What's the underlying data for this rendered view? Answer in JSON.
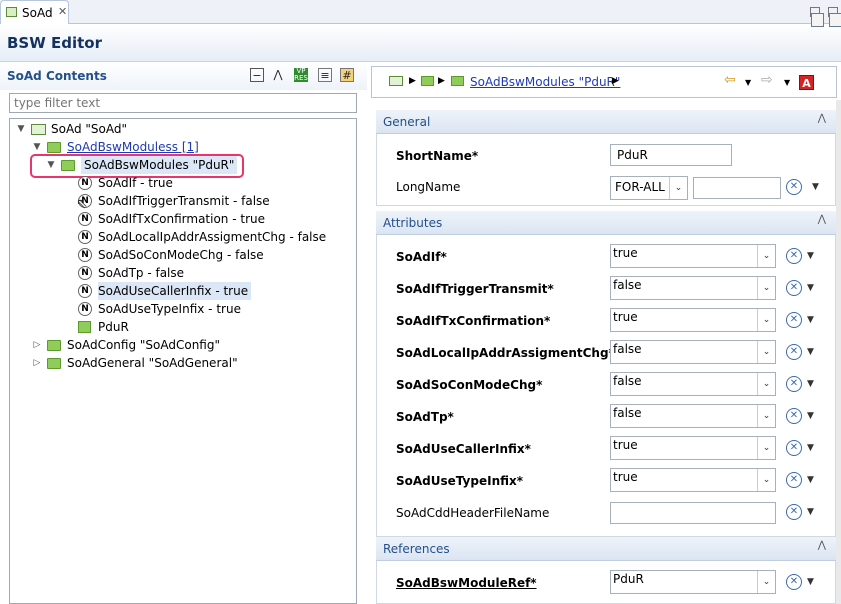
{
  "tab": {
    "label": "SoAd"
  },
  "header": {
    "title": "BSW Editor"
  },
  "left": {
    "title": "SoAd Contents",
    "filter_placeholder": "type filter text",
    "tree": [
      {
        "label": "SoAd \"SoAd\""
      },
      {
        "label": "SoAdBswModuless [1]"
      },
      {
        "label": "SoAdBswModules \"PduR\""
      },
      {
        "label": "SoAdIf - true"
      },
      {
        "label": "SoAdIfTriggerTransmit - false"
      },
      {
        "label": "SoAdIfTxConfirmation - true"
      },
      {
        "label": "SoAdLocalIpAddrAssigmentChg - false"
      },
      {
        "label": "SoAdSoConModeChg - false"
      },
      {
        "label": "SoAdTp - false"
      },
      {
        "label": "SoAdUseCallerInfix - true"
      },
      {
        "label": "SoAdUseTypeInfix - true"
      },
      {
        "label": "PduR"
      },
      {
        "label": "SoAdConfig \"SoAdConfig\""
      },
      {
        "label": "SoAdGeneral \"SoAdGeneral\""
      }
    ]
  },
  "breadcrumb": {
    "item": "SoAdBswModules \"PduR\""
  },
  "general": {
    "title": "General",
    "shortname_label": "ShortName*",
    "shortname_value": "PduR",
    "longname_label": "LongName",
    "longname_lang": "FOR-ALL"
  },
  "attributes": {
    "title": "Attributes",
    "rows": [
      {
        "label": "SoAdIf*",
        "value": "true"
      },
      {
        "label": "SoAdIfTriggerTransmit*",
        "value": "false"
      },
      {
        "label": "SoAdIfTxConfirmation*",
        "value": "true"
      },
      {
        "label": "SoAdLocalIpAddrAssigmentChg*",
        "value": "false"
      },
      {
        "label": "SoAdSoConModeChg*",
        "value": "false"
      },
      {
        "label": "SoAdTp*",
        "value": "false"
      },
      {
        "label": "SoAdUseCallerInfix*",
        "value": "true"
      },
      {
        "label": "SoAdUseTypeInfix*",
        "value": "true"
      },
      {
        "label": "SoAdCddHeaderFileName",
        "value": ""
      }
    ]
  },
  "references": {
    "title": "References",
    "ref_label": "SoAdBswModuleRef*",
    "ref_value": "PduR"
  },
  "colors": {
    "accent": "#23508a",
    "highlight": "#e8356b",
    "folder": "#8fcc5a"
  }
}
